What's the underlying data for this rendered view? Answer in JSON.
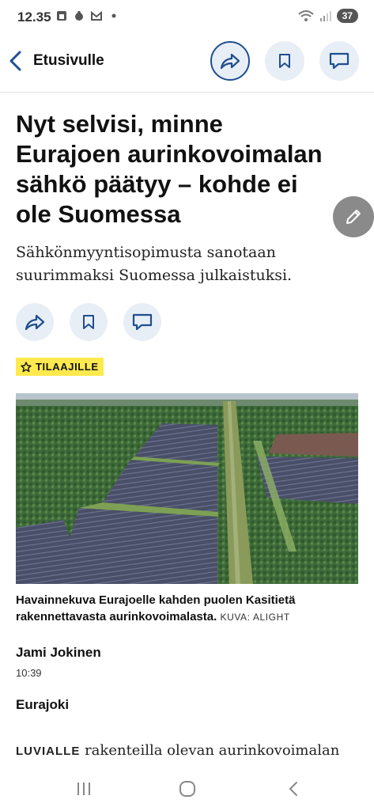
{
  "status_bar": {
    "time": "12.35",
    "battery": "37",
    "notification_icons": [
      "calendar-icon",
      "app-icon",
      "gmail-icon",
      "dot-icon"
    ],
    "right_icons": [
      "wifi-icon",
      "signal-icon",
      "battery-icon"
    ]
  },
  "nav": {
    "back_label": "Etusivulle",
    "actions": [
      "share-icon",
      "bookmark-icon",
      "comment-icon"
    ]
  },
  "article": {
    "headline": "Nyt selvisi, minne Eurajoen aurinkovoimalan sähkö päätyy – kohde ei ole Suomessa",
    "lead": "Sähkönmyyntisopimusta sanotaan suurimmaksi Suomessa julkaistuksi.",
    "badge": "TILAAJILLE",
    "caption": "Havainnekuva Eurajoelle kahden puolen Kasitietä rakennettavasta aurinkovoimalasta.",
    "caption_credit": "KUVA: ALIGHT",
    "author": "Jami Jokinen",
    "time": "10:39",
    "location": "Eurajoki",
    "body_lead_word": "LUVIALLE",
    "body_text": "rakenteilla olevan aurinkovoimalan"
  },
  "colors": {
    "accent": "#1e4f8f",
    "button_bg": "#e8eef6",
    "badge_bg": "#ffe94d"
  }
}
